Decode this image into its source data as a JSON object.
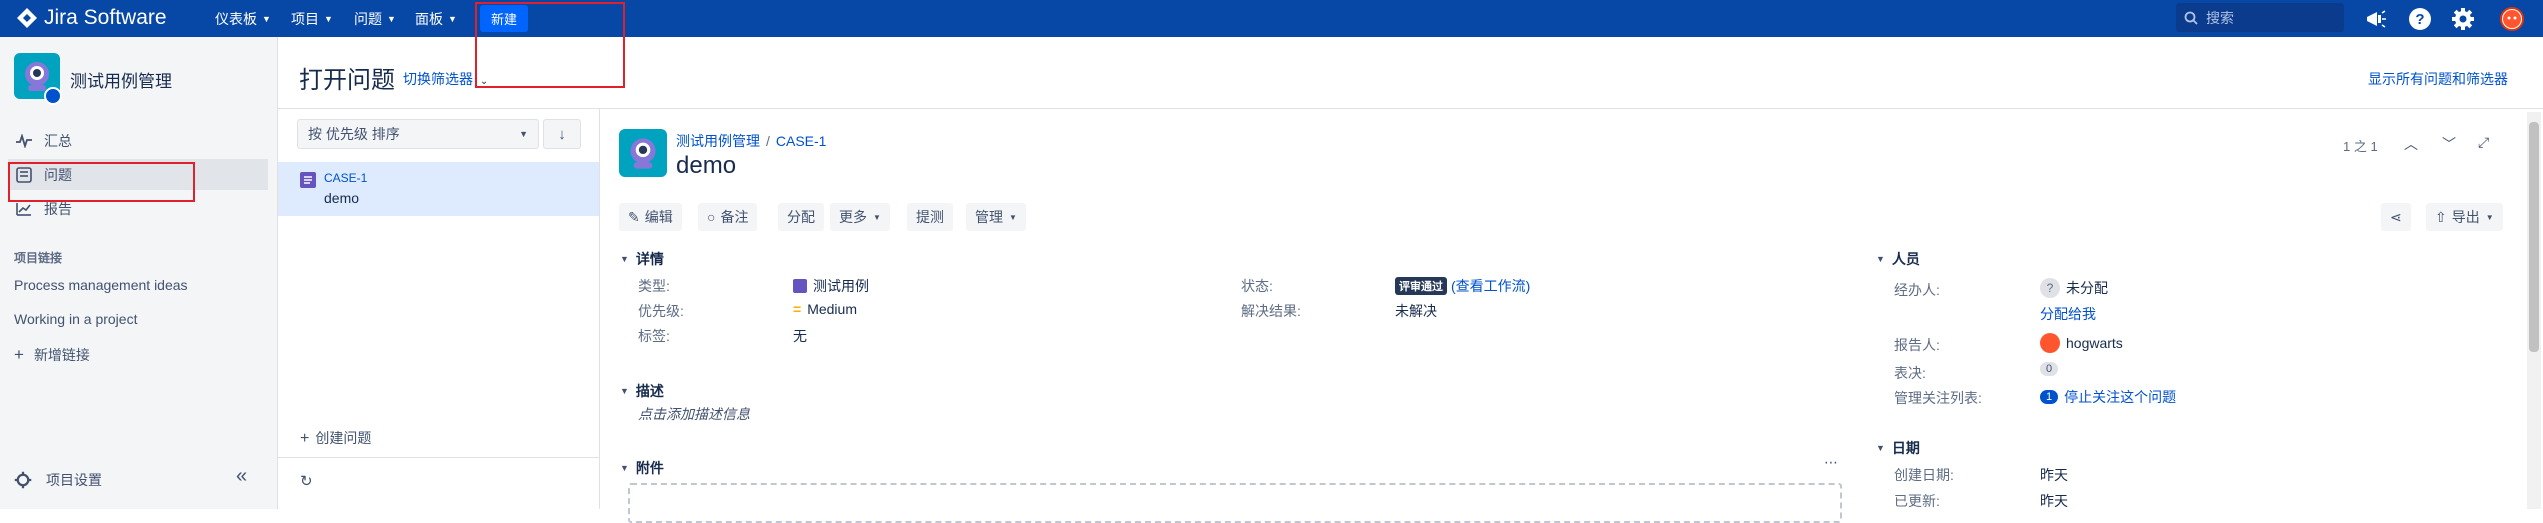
{
  "topbar": {
    "brand": "Jira Software",
    "nav": [
      {
        "label": "仪表板"
      },
      {
        "label": "项目"
      },
      {
        "label": "问题"
      },
      {
        "label": "面板"
      }
    ],
    "create_label": "新建",
    "search_placeholder": "搜索",
    "icons": [
      "notifications-icon",
      "help-icon",
      "settings-icon",
      "user-avatar"
    ]
  },
  "sidebar": {
    "project_name": "测试用例管理",
    "items": [
      {
        "label": "汇总",
        "icon": "summary-icon"
      },
      {
        "label": "问题",
        "icon": "issues-icon"
      },
      {
        "label": "报告",
        "icon": "reports-icon"
      }
    ],
    "links_heading": "项目链接",
    "links": [
      "Process management ideas",
      "Working in a project"
    ],
    "add_link": "新增链接",
    "settings": "项目设置"
  },
  "header": {
    "title": "打开问题",
    "switch_filter": "切换筛选器",
    "show_all": "显示所有问题和筛选器"
  },
  "list": {
    "sort_label": "按 优先级 排序",
    "issues": [
      {
        "key": "CASE-1",
        "summary": "demo"
      }
    ],
    "create_issue": "创建问题"
  },
  "issue": {
    "breadcrumb_project": "测试用例管理",
    "breadcrumb_key": "CASE-1",
    "title": "demo",
    "pager": "1 之 1",
    "toolbar": {
      "edit": "编辑",
      "comment": "备注",
      "assign": "分配",
      "more": "更多",
      "test": "提测",
      "admin": "管理",
      "export": "导出"
    },
    "details": {
      "heading": "详情",
      "type_label": "类型:",
      "type_value": "测试用例",
      "priority_label": "优先级:",
      "priority_value": "Medium",
      "labels_label": "标签:",
      "labels_value": "无",
      "status_label": "状态:",
      "status_value": "评审通过",
      "workflow_link": "(查看工作流)",
      "resolution_label": "解决结果:",
      "resolution_value": "未解决"
    },
    "description": {
      "heading": "描述",
      "placeholder": "点击添加描述信息"
    },
    "attachments": {
      "heading": "附件"
    },
    "people": {
      "heading": "人员",
      "assignee_label": "经办人:",
      "assignee_value": "未分配",
      "assign_to_me": "分配给我",
      "reporter_label": "报告人:",
      "reporter_value": "hogwarts",
      "votes_label": "表决:",
      "votes_value": "0",
      "watchers_label": "管理关注列表:",
      "watchers_count": "1",
      "watchers_action": "停止关注这个问题"
    },
    "dates": {
      "heading": "日期",
      "created_label": "创建日期:",
      "created_value": "昨天",
      "updated_label": "已更新:",
      "updated_value": "昨天"
    }
  },
  "colors": {
    "topbar": "#0747a6",
    "accent": "#0052cc",
    "highlight": "#e0202a"
  }
}
